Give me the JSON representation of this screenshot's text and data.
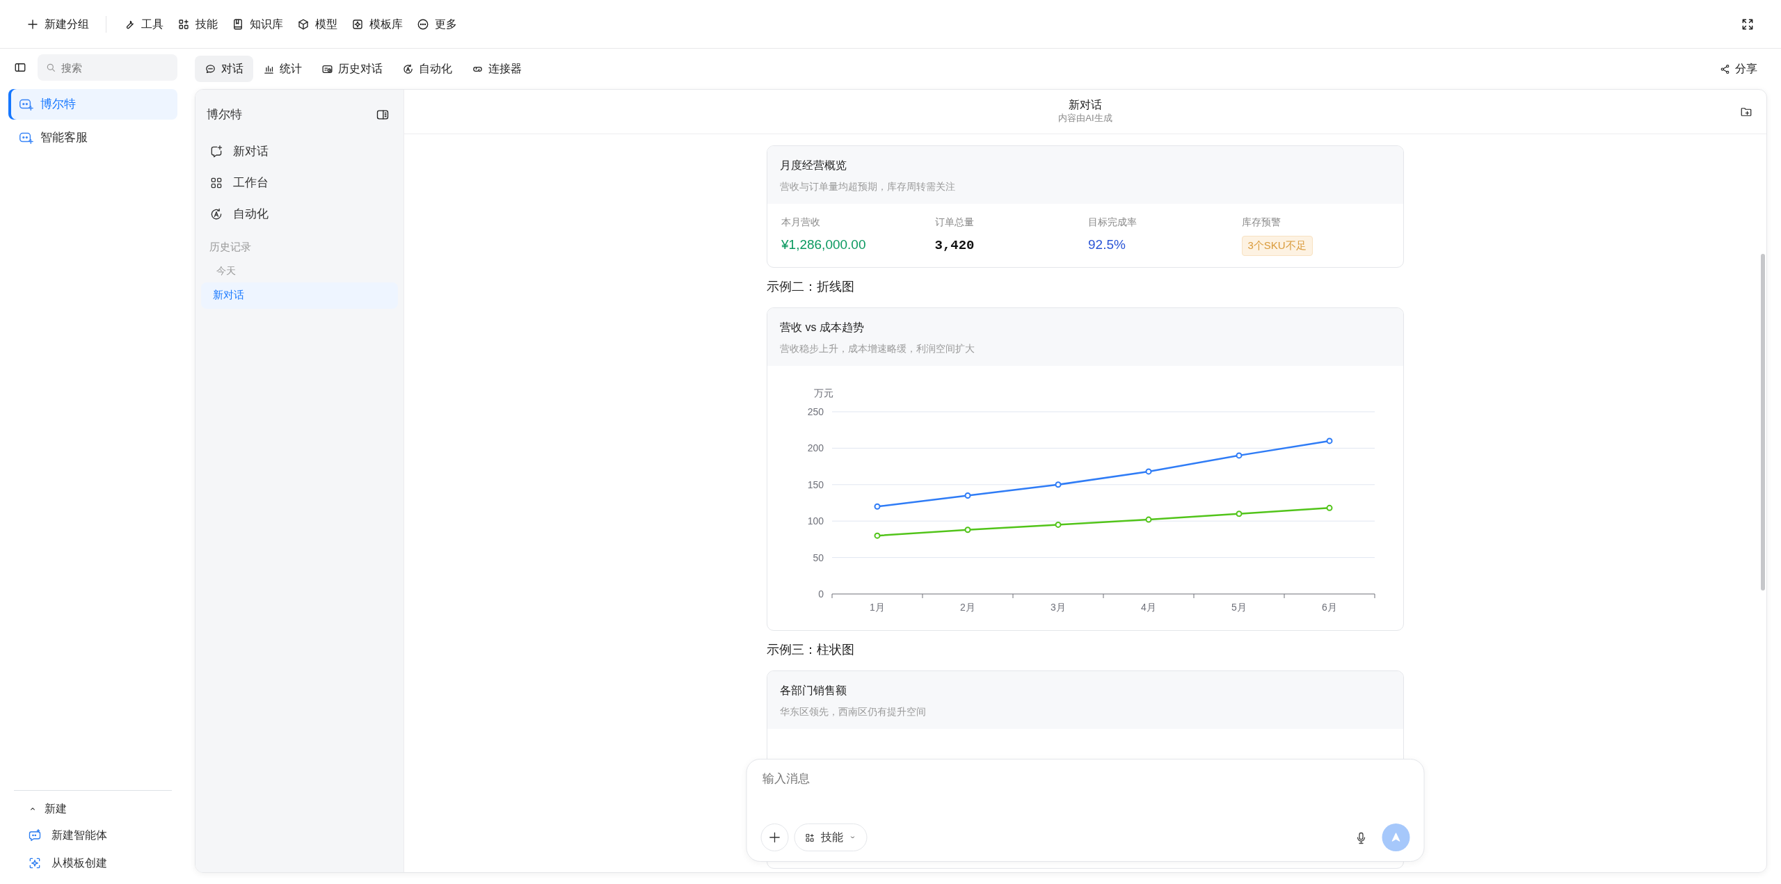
{
  "top_toolbar": {
    "items": [
      "新建分组",
      "工具",
      "技能",
      "知识库",
      "模型",
      "模板库",
      "更多"
    ]
  },
  "search": {
    "placeholder": "搜索"
  },
  "tabs": [
    {
      "label": "对话",
      "selected": true
    },
    {
      "label": "统计",
      "selected": false
    },
    {
      "label": "历史对话",
      "selected": false
    },
    {
      "label": "自动化",
      "selected": false
    },
    {
      "label": "连接器",
      "selected": false
    }
  ],
  "share_button": "分享",
  "agents": [
    {
      "label": "博尔特",
      "selected": true
    },
    {
      "label": "智能客服",
      "selected": false
    }
  ],
  "create_section": {
    "label": "新建",
    "expanded": true,
    "items": [
      "新建智能体",
      "从模板创建"
    ]
  },
  "agent_panel": {
    "title": "博尔特",
    "menu": [
      "新对话",
      "工作台",
      "自动化"
    ],
    "history_heading": "历史记录",
    "history_groups": [
      {
        "label": "今天",
        "items": [
          {
            "label": "新对话",
            "selected": true
          }
        ]
      }
    ]
  },
  "chat": {
    "title": "新对话",
    "subtitle": "内容由AI生成",
    "blocks": [
      {
        "kind": "stats",
        "title": "月度经营概览",
        "subtitle": "营收与订单量均超预期，库存周转需关注",
        "stats": [
          {
            "label": "本月营收",
            "value": "¥1,286,000.00",
            "kind": "money"
          },
          {
            "label": "订单总量",
            "value": "3,420",
            "kind": "count"
          },
          {
            "label": "目标完成率",
            "value": "92.5%",
            "kind": "rate"
          },
          {
            "label": "库存预警",
            "value": "3个SKU不足",
            "kind": "tag"
          }
        ]
      },
      {
        "kind": "heading",
        "text": "示例二：折线图"
      },
      {
        "kind": "chart",
        "title": "营收 vs 成本趋势",
        "subtitle": "营收稳步上升，成本增速略缓，利润空间扩大",
        "chart_data": {
          "type": "line",
          "grid": true,
          "ylabel": "万元",
          "categories": [
            "1月",
            "2月",
            "3月",
            "4月",
            "5月",
            "6月"
          ],
          "ylim": [
            0,
            250
          ],
          "yticks": [
            0,
            50,
            100,
            150,
            200,
            250
          ],
          "series": [
            {
              "color": "#2f7cf6",
              "marker": "circle",
              "values": [
                120,
                135,
                150,
                168,
                190,
                210
              ]
            },
            {
              "color": "#52c41a",
              "marker": "circle",
              "values": [
                80,
                88,
                95,
                102,
                110,
                118
              ]
            }
          ]
        }
      },
      {
        "kind": "heading",
        "text": "示例三：柱状图"
      },
      {
        "kind": "chart",
        "title": "各部门销售额",
        "subtitle": "华东区领先，西南区仍有提升空间"
      }
    ]
  },
  "composer": {
    "placeholder": "输入消息",
    "skill_button": "技能"
  }
}
